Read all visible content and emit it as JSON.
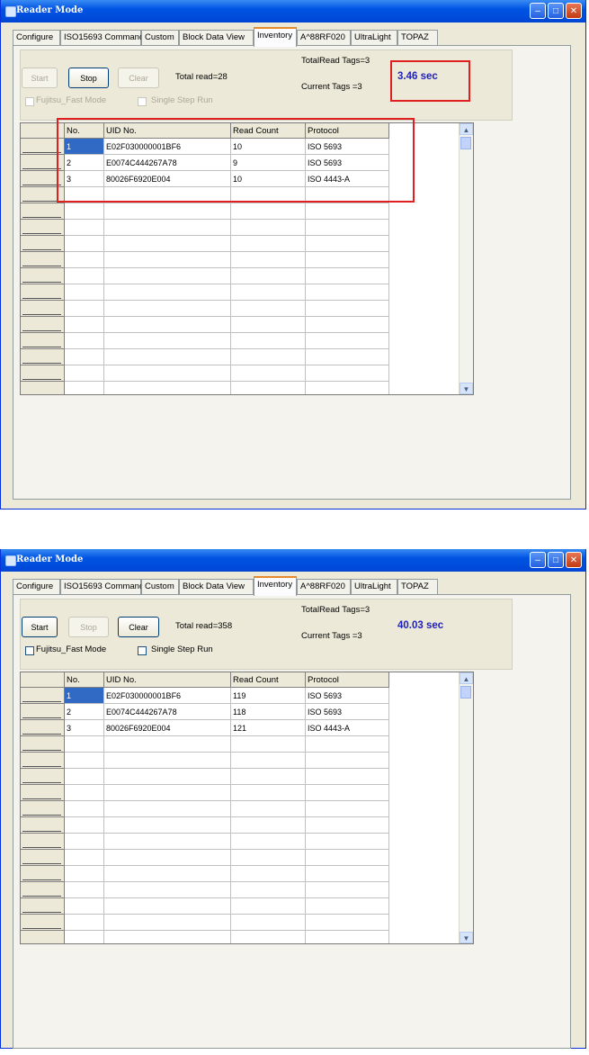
{
  "windows": [
    {
      "title": "Reader Mode",
      "tabs": [
        "Configure",
        "ISO15693 Command",
        "Custom",
        "Block Data View",
        "Inventory",
        "A^88RF020",
        "UltraLight",
        "TOPAZ"
      ],
      "active_tab": "Inventory",
      "buttons": {
        "start": "Start",
        "stop": "Stop",
        "clear": "Clear"
      },
      "button_states": {
        "start_enabled": false,
        "stop_enabled": true,
        "clear_enabled": false
      },
      "total_read": "Total read=28",
      "total_read_tags": "TotalRead Tags=3",
      "current_tags": "Current Tags =3",
      "elapsed": "3.46 sec",
      "checkbox_fast_mode": "Fujitsu_Fast Mode",
      "checkbox_single_step": "Single Step Run",
      "checkboxes_enabled": false,
      "columns": [
        "No.",
        "UID No.",
        "Read Count",
        "Protocol"
      ],
      "rows": [
        {
          "no": "1",
          "uid": "E02F030000001BF6",
          "count": "10",
          "protocol": "ISO 5693"
        },
        {
          "no": "2",
          "uid": "E0074C444267A78",
          "count": "9",
          "protocol": "ISO 5693"
        },
        {
          "no": "3",
          "uid": "80026F6920E004",
          "count": "10",
          "protocol": "ISO 4443-A"
        }
      ],
      "highlight_boxes": true
    },
    {
      "title": "Reader Mode",
      "tabs": [
        "Configure",
        "ISO15693 Command",
        "Custom",
        "Block Data View",
        "Inventory",
        "A^88RF020",
        "UltraLight",
        "TOPAZ"
      ],
      "active_tab": "Inventory",
      "buttons": {
        "start": "Start",
        "stop": "Stop",
        "clear": "Clear"
      },
      "button_states": {
        "start_enabled": true,
        "stop_enabled": false,
        "clear_enabled": true
      },
      "total_read": "Total read=358",
      "total_read_tags": "TotalRead Tags=3",
      "current_tags": "Current Tags =3",
      "elapsed": "40.03 sec",
      "checkbox_fast_mode": "Fujitsu_Fast Mode",
      "checkbox_single_step": "Single Step Run",
      "checkboxes_enabled": true,
      "columns": [
        "No.",
        "UID No.",
        "Read Count",
        "Protocol"
      ],
      "rows": [
        {
          "no": "1",
          "uid": "E02F030000001BF6",
          "count": "119",
          "protocol": "ISO 5693"
        },
        {
          "no": "2",
          "uid": "E0074C444267A78",
          "count": "118",
          "protocol": "ISO 5693"
        },
        {
          "no": "3",
          "uid": "80026F6920E004",
          "count": "121",
          "protocol": "ISO 4443-A"
        }
      ],
      "highlight_boxes": false
    }
  ],
  "colors": {
    "titlebar": "#0054e3",
    "elapsed_text": "#1f1fbf",
    "highlight": "#e02020",
    "selected_cell": "#316ac5"
  }
}
